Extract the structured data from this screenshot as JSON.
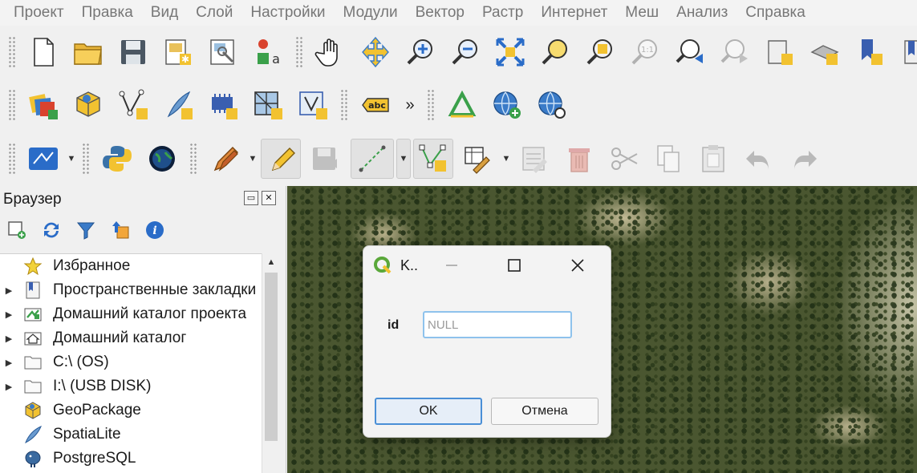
{
  "menu": [
    "Проект",
    "Правка",
    "Вид",
    "Слой",
    "Настройки",
    "Модули",
    "Вектор",
    "Растр",
    "Интернет",
    "Меш",
    "Анализ",
    "Справка"
  ],
  "toolbar1": {
    "icons": [
      "new-project-icon",
      "open-project-icon",
      "save-project-icon",
      "new-print-layout-icon",
      "layout-manager-icon",
      "style-manager-icon",
      "pan-icon",
      "pan-to-selection-icon",
      "zoom-in-icon",
      "zoom-out-icon",
      "zoom-full-icon",
      "zoom-to-selection-icon",
      "zoom-to-layer-icon",
      "zoom-native-icon",
      "zoom-last-icon",
      "zoom-next-icon",
      "new-spatial-bookmark-icon",
      "new-3d-map-icon",
      "new-bookmark-icon",
      "show-bookmarks-icon"
    ]
  },
  "toolbar2": {
    "icons": [
      "data-source-manager-icon",
      "new-geopackage-layer-icon",
      "new-shapefile-layer-icon",
      "new-spatialite-layer-icon",
      "new-temporary-layer-icon",
      "new-mesh-layer-icon",
      "new-virtual-layer-icon",
      "label-abc-icon",
      "georeferencer-icon",
      "add-wms-layer-icon",
      "metasearch-icon"
    ],
    "label_tool_text": "abc",
    "more_glyph": "»"
  },
  "toolbar3": {
    "icons": [
      "processing-model-icon",
      "python-console-icon",
      "globe-icon",
      "edits-icon",
      "toggle-editing-icon",
      "save-edits-icon",
      "digitize-line-icon",
      "vertex-tool-icon",
      "modify-attributes-icon",
      "delete-selected-icon",
      "cut-features-icon",
      "copy-features-icon",
      "paste-features-icon",
      "undo-icon",
      "redo-icon"
    ]
  },
  "browser": {
    "title": "Браузер",
    "tree": [
      {
        "label": "Избранное",
        "icon": "star-icon",
        "expandable": false
      },
      {
        "label": "Пространственные закладки",
        "icon": "bookmarks-icon",
        "expandable": true
      },
      {
        "label": "Домашний каталог проекта",
        "icon": "project-home-icon",
        "expandable": true
      },
      {
        "label": "Домашний каталог",
        "icon": "home-folder-icon",
        "expandable": true
      },
      {
        "label": "C:\\ (OS)",
        "icon": "folder-icon",
        "expandable": true
      },
      {
        "label": "I:\\ (USB DISK)",
        "icon": "folder-icon",
        "expandable": true
      },
      {
        "label": "GeoPackage",
        "icon": "geopackage-icon",
        "expandable": false
      },
      {
        "label": "SpatiaLite",
        "icon": "spatialite-icon",
        "expandable": false
      },
      {
        "label": "PostgreSQL",
        "icon": "postgresql-icon",
        "expandable": false
      }
    ]
  },
  "dialog": {
    "title": "K..",
    "field_label": "id",
    "field_value": "",
    "field_placeholder": "NULL",
    "ok_label": "OK",
    "cancel_label": "Отмена"
  },
  "colors": {
    "accent": "#4a8fd6",
    "focus_border": "#8ec2ec",
    "map_base": "#4a5630"
  }
}
